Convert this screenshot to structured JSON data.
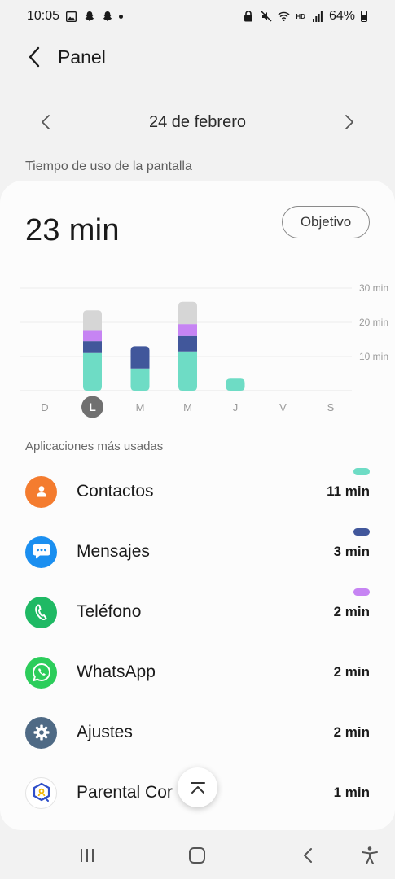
{
  "status_bar": {
    "time": "10:05",
    "battery_percent": "64%",
    "network_label": "HD"
  },
  "header": {
    "title": "Panel"
  },
  "date_nav": {
    "date": "24 de febrero"
  },
  "section_title": "Tiempo de uso de la pantalla",
  "summary": {
    "total": "23 min",
    "goal_label": "Objetivo"
  },
  "colors": {
    "contacts": "#6edcc5",
    "messages": "#41579b",
    "phone": "#c684f3",
    "other": "#d6d6d6",
    "selected_day": "#707070"
  },
  "chart_data": {
    "type": "bar",
    "stacked": true,
    "categories": [
      "D",
      "L",
      "M",
      "M",
      "J",
      "V",
      "S"
    ],
    "selected_index": 1,
    "ylim": [
      0,
      30
    ],
    "yticks": [
      10,
      20,
      30
    ],
    "ytick_labels": [
      "10 min",
      "20 min",
      "30 min"
    ],
    "series": [
      {
        "key": "contacts",
        "values": [
          0,
          11,
          6.5,
          11.5,
          3.5,
          0,
          0
        ]
      },
      {
        "key": "messages",
        "values": [
          0,
          3.5,
          6.5,
          4.5,
          0,
          0,
          0
        ]
      },
      {
        "key": "phone",
        "values": [
          0,
          3,
          0,
          3.5,
          0,
          0,
          0
        ]
      },
      {
        "key": "other",
        "values": [
          0,
          6,
          0,
          6.5,
          0,
          0,
          0
        ]
      }
    ]
  },
  "apps_section_title": "Aplicaciones más usadas",
  "apps": [
    {
      "name": "Contactos",
      "time": "11 min",
      "icon": "person-icon",
      "color": "#f47c2f",
      "pill": "#6edcc5"
    },
    {
      "name": "Mensajes",
      "time": "3 min",
      "icon": "chat-bubble-icon",
      "color": "#1b8ff0",
      "pill": "#41579b"
    },
    {
      "name": "Teléfono",
      "time": "2 min",
      "icon": "phone-icon",
      "color": "#1fb964",
      "pill": "#c684f3"
    },
    {
      "name": "WhatsApp",
      "time": "2 min",
      "icon": "whatsapp-icon",
      "color": "#2ccd5b",
      "pill": ""
    },
    {
      "name": "Ajustes",
      "time": "2 min",
      "icon": "gear-icon",
      "color": "#4f6a85",
      "pill": ""
    },
    {
      "name": "Parental Cor",
      "time": "1 min",
      "icon": "parental-control-icon",
      "color": "#ffffff",
      "pill": ""
    }
  ]
}
